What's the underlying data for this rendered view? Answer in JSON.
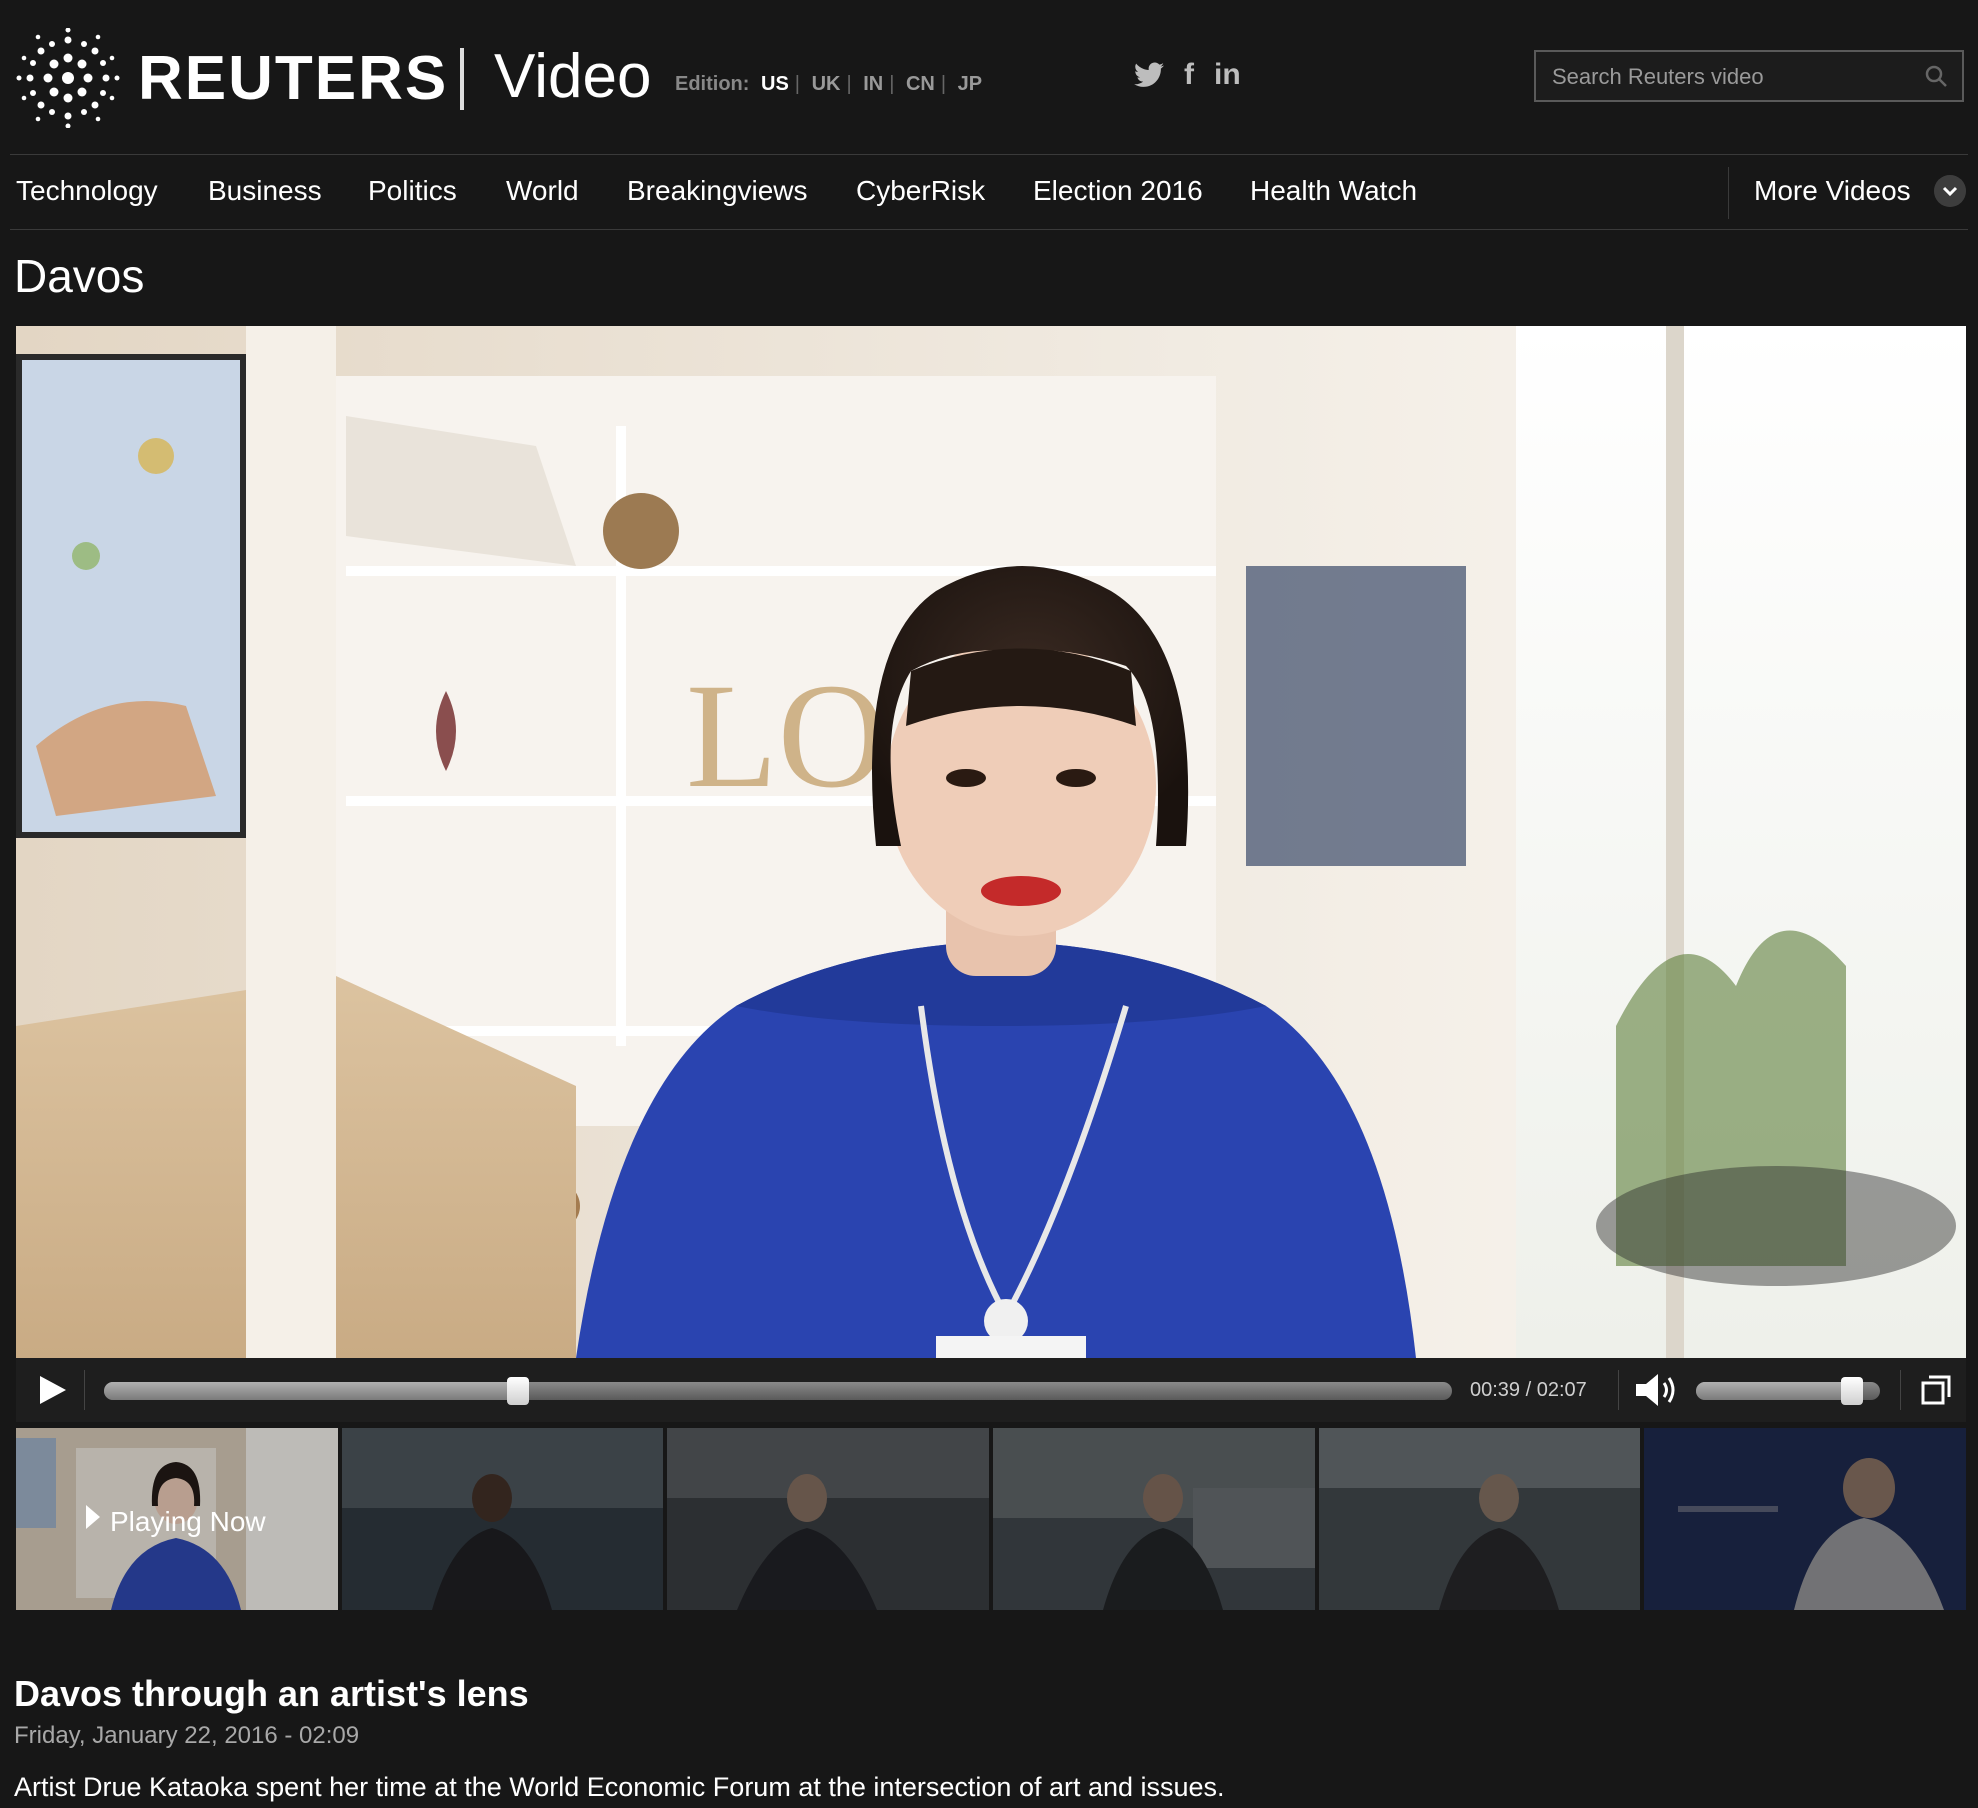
{
  "header": {
    "logo_text": "REUTERS",
    "section": "Video",
    "edition_label": "Edition:",
    "editions": [
      "US",
      "UK",
      "IN",
      "CN",
      "JP"
    ],
    "active_edition": "US",
    "social": [
      {
        "icon": "twitter-icon",
        "glyph": "🐦"
      },
      {
        "icon": "facebook-icon",
        "glyph": "f"
      },
      {
        "icon": "linkedin-icon",
        "glyph": "in"
      }
    ],
    "search_placeholder": "Search Reuters video"
  },
  "nav": {
    "items": [
      "Technology",
      "Business",
      "Politics",
      "World",
      "Breakingviews",
      "CyberRisk",
      "Election 2016",
      "Health Watch"
    ],
    "more_label": "More Videos"
  },
  "page_title": "Davos",
  "player": {
    "current_time": "00:39",
    "duration": "02:07",
    "time_display": "00:39 / 02:07",
    "progress_fraction": 0.307,
    "volume_fraction": 0.85
  },
  "thumbnails": {
    "playing_now_label": "Playing Now",
    "count": 6
  },
  "story": {
    "title": "Davos through an artist's lens",
    "date": "Friday, January 22, 2016 - 02:09",
    "description": "Artist Drue Kataoka spent her time at the World Economic Forum at the intersection of art and issues."
  },
  "colors": {
    "background": "#171717",
    "text": "#ffffff",
    "muted": "#a8a8a8",
    "dress_blue": "#2a44b0"
  }
}
